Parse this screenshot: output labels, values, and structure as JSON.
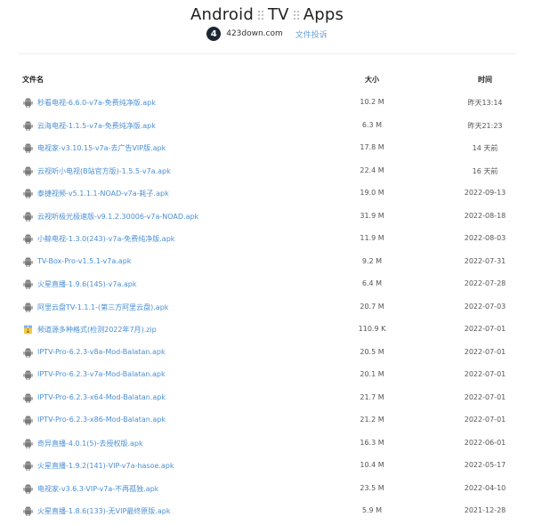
{
  "header": {
    "title_parts": [
      "Android",
      "TV",
      "Apps"
    ],
    "logo_text": "4",
    "site_name": "423down.com",
    "feedback_label": "文件投诉"
  },
  "table": {
    "columns": {
      "name": "文件名",
      "size": "大小",
      "time": "时间"
    },
    "rows": [
      {
        "name": "秒看电视-6.6.0-v7a-免费纯净版.apk",
        "size": "10.2 M",
        "time": "昨天13:14",
        "icon": "android-icon"
      },
      {
        "name": "云海电视-1.1.5-v7a-免费纯净版.apk",
        "size": "6.3 M",
        "time": "昨天21:23",
        "icon": "android-icon"
      },
      {
        "name": "电视家-v3.10.15-v7a-去广告VIP版.apk",
        "size": "17.8 M",
        "time": "14 天前",
        "icon": "android-icon"
      },
      {
        "name": "云视听小电视(B站官方版)-1.5.5-v7a.apk",
        "size": "22.4 M",
        "time": "16 天前",
        "icon": "android-icon"
      },
      {
        "name": "泰捷视频-v5.1.1.1-NOAD-v7a-耗子.apk",
        "size": "19.0 M",
        "time": "2022-09-13",
        "icon": "android-icon"
      },
      {
        "name": "云视听极光极速版-v9.1.2.30006-v7a-NOAD.apk",
        "size": "31.9 M",
        "time": "2022-08-18",
        "icon": "android-icon"
      },
      {
        "name": "小鲸电视-1.3.0(243)-v7a-免费纯净版.apk",
        "size": "11.9 M",
        "time": "2022-08-03",
        "icon": "android-icon"
      },
      {
        "name": "TV-Box-Pro-v1.5.1-v7a.apk",
        "size": "9.2 M",
        "time": "2022-07-31",
        "icon": "android-icon"
      },
      {
        "name": "火星直播-1.9.6(145)-v7a.apk",
        "size": "6.4 M",
        "time": "2022-07-28",
        "icon": "android-icon"
      },
      {
        "name": "阿里云盘TV-1.1.1-(第三方阿里云盘).apk",
        "size": "20.7 M",
        "time": "2022-07-03",
        "icon": "android-icon"
      },
      {
        "name": "频道源多种格式(检测2022年7月).zip",
        "size": "110.9 K",
        "time": "2022-07-01",
        "icon": "zip-icon"
      },
      {
        "name": "IPTV-Pro-6.2.3-v8a-Mod-Balatan.apk",
        "size": "20.5 M",
        "time": "2022-07-01",
        "icon": "android-icon"
      },
      {
        "name": "IPTV-Pro-6.2.3-v7a-Mod-Balatan.apk",
        "size": "20.1 M",
        "time": "2022-07-01",
        "icon": "android-icon"
      },
      {
        "name": "IPTV-Pro-6.2.3-x64-Mod-Balatan.apk",
        "size": "21.7 M",
        "time": "2022-07-01",
        "icon": "android-icon"
      },
      {
        "name": "IPTV-Pro-6.2.3-x86-Mod-Balatan.apk",
        "size": "21.2 M",
        "time": "2022-07-01",
        "icon": "android-icon"
      },
      {
        "name": "奇异直播-4.0.1(5)-去授权版.apk",
        "size": "16.3 M",
        "time": "2022-06-01",
        "icon": "android-icon"
      },
      {
        "name": "火星直播-1.9.2(141)-VIP-v7a-hasoe.apk",
        "size": "10.4 M",
        "time": "2022-05-17",
        "icon": "android-icon"
      },
      {
        "name": "电视家-v3.6.3-VIP-v7a-不再孤独.apk",
        "size": "23.5 M",
        "time": "2022-04-10",
        "icon": "android-icon"
      },
      {
        "name": "火星直播-1.8.6(133)-无VIP最终原版.apk",
        "size": "5.9 M",
        "time": "2021-12-28",
        "icon": "android-icon"
      }
    ]
  }
}
